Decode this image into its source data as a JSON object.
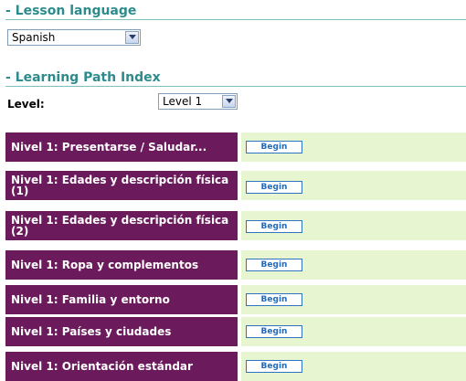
{
  "lesson_language": {
    "title": "- Lesson language",
    "selected": "Spanish"
  },
  "learning_path": {
    "title": "- Learning Path Index",
    "level_label": "Level:",
    "level_selected": "Level 1"
  },
  "lessons": [
    {
      "name": "Nivel 1: Presentarse / Saludar...",
      "button": "Begin"
    },
    {
      "name": "Nivel 1: Edades y descripción física (1)",
      "button": "Begin"
    },
    {
      "name": "Nivel 1: Edades y descripción física (2)",
      "button": "Begin"
    },
    {
      "name": "Nivel 1: Ropa y complementos",
      "button": "Begin"
    },
    {
      "name": "Nivel 1: Familia y entorno",
      "button": "Begin"
    },
    {
      "name": "Nivel 1: Países y ciudades",
      "button": "Begin"
    },
    {
      "name": "Nivel 1: Orientación estándar",
      "button": "Begin"
    }
  ],
  "colors": {
    "heading": "#2e8b8b",
    "lesson_bg": "#6b1a5b",
    "cell_bg": "#e7f5d0",
    "button_border": "#2e74c0"
  },
  "icons": {
    "dropdown": "chevron-down-icon"
  }
}
